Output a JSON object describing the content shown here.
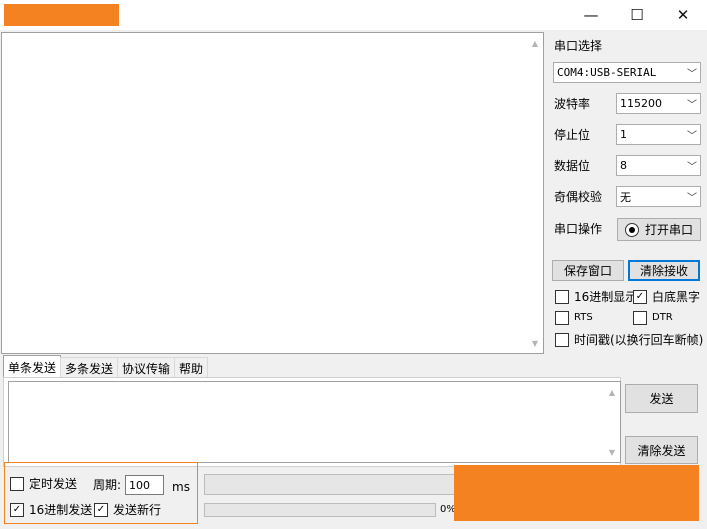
{
  "window": {
    "minimize_glyph": "—",
    "maximize_glyph": "☐",
    "close_glyph": "✕"
  },
  "settings": {
    "port_select_label": "串口选择",
    "port_value": "COM4:USB-SERIAL",
    "baud_label": "波特率",
    "baud_value": "115200",
    "stopbits_label": "停止位",
    "stopbits_value": "1",
    "databits_label": "数据位",
    "databits_value": "8",
    "parity_label": "奇偶校验",
    "parity_value": "无",
    "port_op_label": "串口操作",
    "open_port_label": "打开串口"
  },
  "actions": {
    "save_window": "保存窗口",
    "clear_receive": "清除接收"
  },
  "options": {
    "hex_display": {
      "label": "16进制显示",
      "checked": false
    },
    "white_bg": {
      "label": "白底黑字",
      "checked": true
    },
    "rts": {
      "label": "RTS",
      "checked": false
    },
    "dtr": {
      "label": "DTR",
      "checked": false
    },
    "timestamp": {
      "label": "时间戳(以换行回车断帧)",
      "checked": false
    }
  },
  "tabs": [
    {
      "label": "单条发送",
      "active": true
    },
    {
      "label": "多条发送",
      "active": false
    },
    {
      "label": "协议传输",
      "active": false
    },
    {
      "label": "帮助",
      "active": false
    }
  ],
  "send": {
    "send_button": "发送",
    "clear_send_button": "清除发送",
    "timed_send": {
      "label": "定时发送",
      "checked": false
    },
    "period_label": "周期:",
    "period_value": "100",
    "period_unit": "ms",
    "hex_send": {
      "label": "16进制发送",
      "checked": true
    },
    "send_newline": {
      "label": "发送新行",
      "checked": true
    },
    "progress_text": "0%",
    "progress_value": 0
  },
  "colors": {
    "redaction": "#f58220",
    "accent_border": "#0078d7"
  }
}
